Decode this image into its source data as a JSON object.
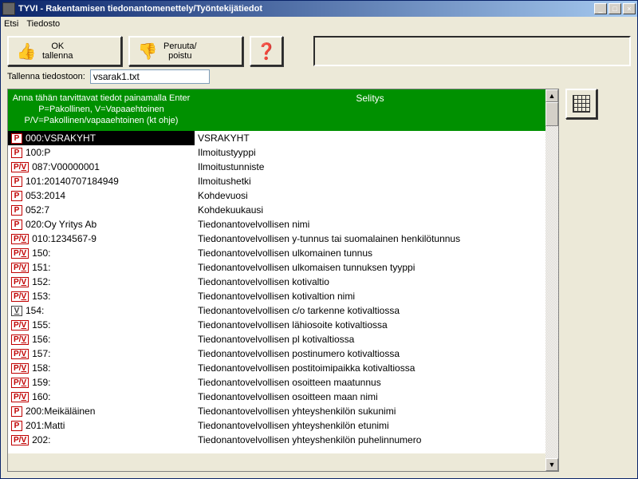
{
  "window": {
    "title": "TYVI - Rakentamisen tiedonantomenettely/Työntekijätiedot",
    "min": "_",
    "max": "□",
    "close": "×"
  },
  "menu": {
    "item1": "Etsi",
    "item2": "Tiedosto"
  },
  "toolbar": {
    "ok_label": "OK\ntallenna",
    "cancel_label": "Peruuta/\npoistu"
  },
  "save": {
    "label": "Tallenna tiedostoon:",
    "filename": "vsarak1.txt"
  },
  "grid": {
    "header1": "Anna tähän tarvittavat tiedot painamalla Enter\nP=Pakollinen, V=Vapaaehtoinen\nP/V=Pakollinen/vapaaehtoinen (kt ohje)",
    "header2": "Selitys",
    "rows": [
      {
        "tag": "P",
        "code": "000:VSRAKYHT",
        "desc": "VSRAKYHT",
        "selected": true
      },
      {
        "tag": "P",
        "code": "100:P",
        "desc": "Ilmoitustyyppi"
      },
      {
        "tag": "PV",
        "code": "087:V00000001",
        "desc": "Ilmoitustunniste"
      },
      {
        "tag": "P",
        "code": "101:20140707184949",
        "desc": "Ilmoitushetki"
      },
      {
        "tag": "P",
        "code": "053:2014",
        "desc": "Kohdevuosi"
      },
      {
        "tag": "P",
        "code": "052:7",
        "desc": "Kohdekuukausi"
      },
      {
        "tag": "P",
        "code": "020:Oy Yritys Ab",
        "desc": "Tiedonantovelvollisen nimi"
      },
      {
        "tag": "PV",
        "code": "010:1234567-9",
        "desc": "Tiedonantovelvollisen y-tunnus tai suomalainen henkilötunnus"
      },
      {
        "tag": "PV",
        "code": "150:",
        "desc": "Tiedonantovelvollisen ulkomainen tunnus"
      },
      {
        "tag": "PV",
        "code": "151:",
        "desc": "Tiedonantovelvollisen ulkomaisen tunnuksen tyyppi"
      },
      {
        "tag": "PV",
        "code": "152:",
        "desc": "Tiedonantovelvollisen kotivaltio"
      },
      {
        "tag": "PV",
        "code": "153:",
        "desc": "Tiedonantovelvollisen kotivaltion nimi"
      },
      {
        "tag": "V",
        "code": "154:",
        "desc": "Tiedonantovelvollisen c/o tarkenne kotivaltiossa"
      },
      {
        "tag": "PV",
        "code": "155:",
        "desc": "Tiedonantovelvollisen lähiosoite kotivaltiossa"
      },
      {
        "tag": "PV",
        "code": "156:",
        "desc": "Tiedonantovelvollisen pl kotivaltiossa"
      },
      {
        "tag": "PV",
        "code": "157:",
        "desc": "Tiedonantovelvollisen postinumero kotivaltiossa"
      },
      {
        "tag": "PV",
        "code": "158:",
        "desc": "Tiedonantovelvollisen postitoimipaikka kotivaltiossa"
      },
      {
        "tag": "PV",
        "code": "159:",
        "desc": "Tiedonantovelvollisen osoitteen maatunnus"
      },
      {
        "tag": "PV",
        "code": "160:",
        "desc": "Tiedonantovelvollisen osoitteen maan nimi"
      },
      {
        "tag": "P",
        "code": "200:Meikäläinen",
        "desc": "Tiedonantovelvollisen yhteyshenkilön sukunimi"
      },
      {
        "tag": "P",
        "code": "201:Matti",
        "desc": "Tiedonantovelvollisen yhteyshenkilön etunimi"
      },
      {
        "tag": "PV",
        "code": "202:",
        "desc": "Tiedonantovelvollisen yhteyshenkilön puhelinnumero"
      }
    ]
  },
  "scroll": {
    "up": "▲",
    "down": "▼"
  }
}
